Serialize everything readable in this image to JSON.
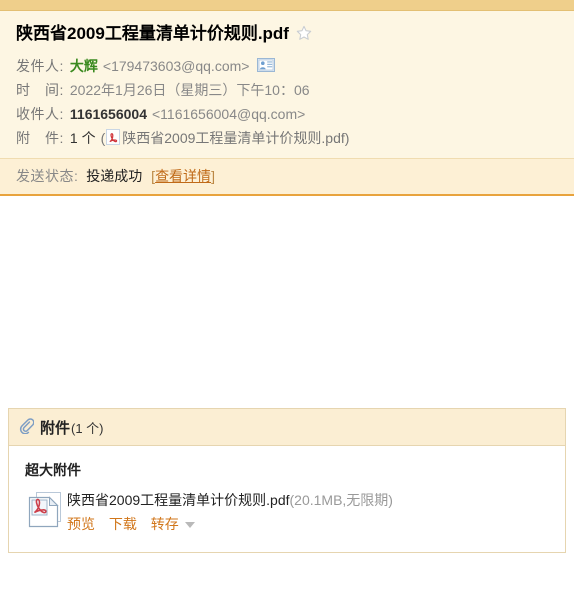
{
  "mail": {
    "subject": "陕西省2009工程量清单计价规则.pdf",
    "star_title": "标记星标",
    "from": {
      "label": "发件人:",
      "name": "大辉",
      "address": "<179473603@qq.com>"
    },
    "date": {
      "label": "时　间:",
      "value": "2022年1月26日（星期三）下午10：06"
    },
    "to": {
      "label": "收件人:",
      "name": "1161656004",
      "address": "<1161656004@qq.com>"
    },
    "attachment_line": {
      "label": "附　件:",
      "count": "1 个",
      "open_paren": "(",
      "file_name": "陕西省2009工程量清单计价规则.pdf",
      "close_paren": ")"
    }
  },
  "status": {
    "label": "发送状态:",
    "value": "投递成功",
    "left_bracket": "[",
    "link": "查看详情",
    "right_bracket": "]"
  },
  "attachments_panel": {
    "title": "附件",
    "count": "(1 个)",
    "group_title": "超大附件",
    "items": [
      {
        "file_name": "陕西省2009工程量清单计价规则.pdf",
        "meta": "(20.1MB,无限期)",
        "actions": [
          "预览",
          "下载",
          "转存"
        ]
      }
    ]
  },
  "colors": {
    "accent_gold": "#efcf8b",
    "header_bg": "#fdf6e3",
    "status_bg": "#fdf0d5",
    "status_border": "#e8a33d",
    "sender_green": "#3a8a1f",
    "link_orange": "#d1761a"
  }
}
